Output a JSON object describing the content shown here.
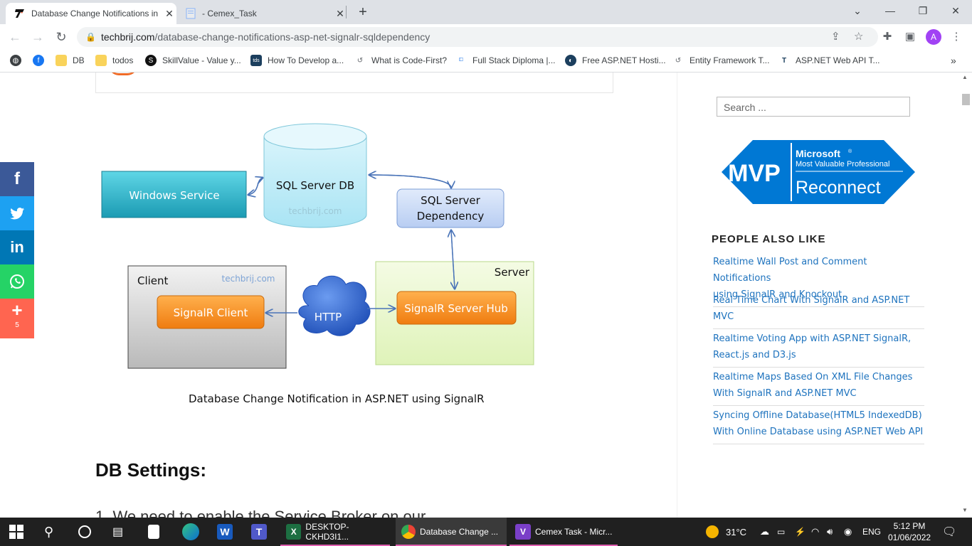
{
  "tabs": [
    {
      "title": "Database Change Notifications in",
      "active": true
    },
    {
      "title": "- Cemex_Task",
      "active": false
    }
  ],
  "url": {
    "host": "techbrij.com",
    "path": "/database-change-notifications-asp-net-signalr-sqldependency"
  },
  "avatar_letter": "A",
  "bookmarks": [
    "DB",
    "todos",
    "SkillValue - Value y...",
    "How To Develop a...",
    "What is Code-First?",
    "Full Stack Diploma |...",
    "Free ASP.NET Hosti...",
    "Entity Framework T...",
    "ASP.NET Web API T..."
  ],
  "bookmark_icon_text": {
    "tds": "tds",
    "net": "NET"
  },
  "social": {
    "share_count": "5",
    "colors": {
      "facebook": "#3b5998",
      "twitter": "#1da1f2",
      "linkedin": "#0077b5",
      "whatsapp": "#25d366",
      "more": "#ff6550"
    }
  },
  "diagram": {
    "windows_service": "Windows Service",
    "sql_db": "SQL Server DB",
    "watermark": "techbrij.com",
    "sql_dep_line1": "SQL Server",
    "sql_dep_line2": "Dependency",
    "client": "Client",
    "client_watermark": "techbrij.com",
    "signalr_client": "SignalR Client",
    "http": "HTTP",
    "server": "Server",
    "signalr_hub": "SignalR Server Hub"
  },
  "caption": "Database Change Notification in ASP.NET using SignalR",
  "heading": "DB Settings:",
  "list_cut": "1. We need to enable the Service Broker on our",
  "sidebar": {
    "search_placeholder": "Search ...",
    "mvp": {
      "big": "MVP",
      "brand": "Microsoft",
      "reg": "®",
      "sub": "Most Valuable Professional",
      "reconnect": "Reconnect"
    },
    "people_also_like": "PEOPLE ALSO LIKE",
    "related": [
      {
        "line1": "Realtime Wall Post and Comment Notifications",
        "line2": "using SignalR and Knockout"
      },
      {
        "line1": "Real Time Chart With SignalR and ASP.NET",
        "line2": "MVC"
      },
      {
        "line1": "Realtime Voting App with ASP.NET SignalR,",
        "line2": "React.js and D3.js"
      },
      {
        "line1": "Realtime Maps Based On XML File Changes",
        "line2": "With SignalR and ASP.NET MVC"
      },
      {
        "line1": "Syncing Offline Database(HTML5 IndexedDB)",
        "line2": "With Online Database using ASP.NET Web API"
      }
    ]
  },
  "taskbar": {
    "apps": [
      "DESKTOP-CKHD3I1...",
      "Database Change ...",
      "Cemex Task - Micr..."
    ],
    "app_icon_text": {
      "word": "W",
      "teams": "T",
      "vs": "V"
    },
    "weather": "31°C",
    "lang": "ENG",
    "time": "5:12 PM",
    "date": "01/06/2022"
  }
}
